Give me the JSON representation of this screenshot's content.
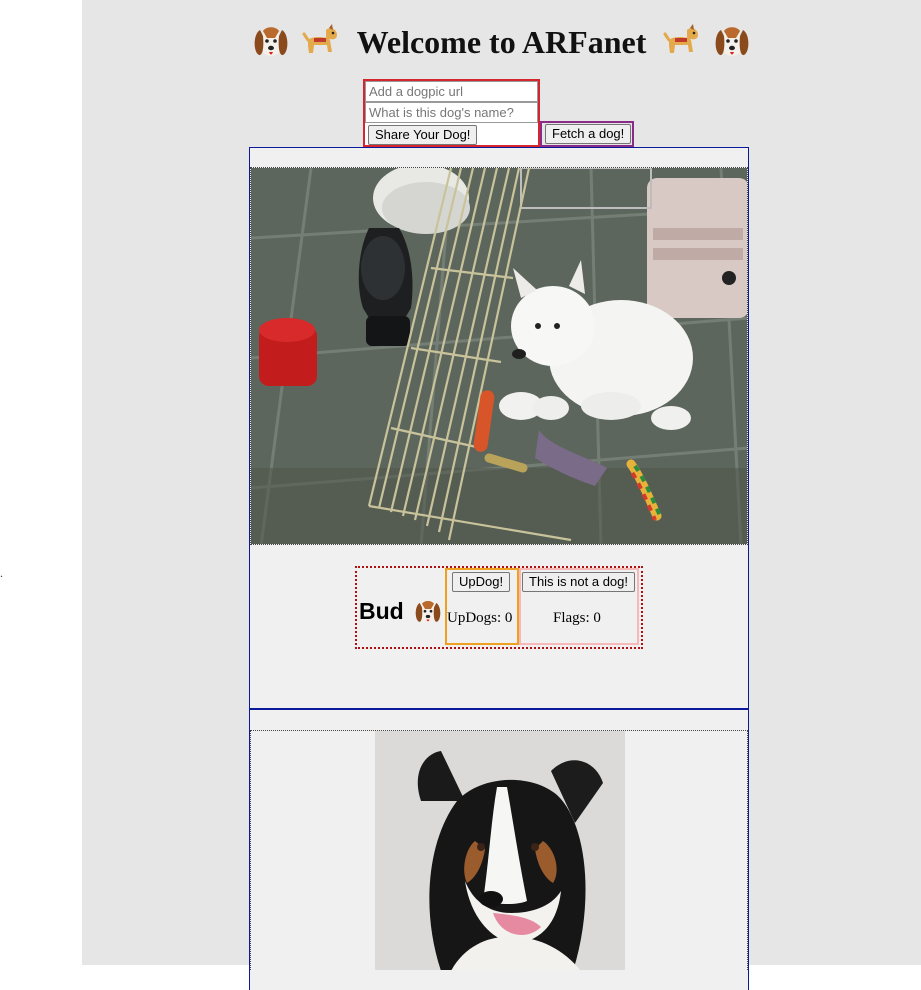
{
  "header": {
    "title": "Welcome to ARFanet",
    "emojis_left": [
      "beagle-face-emoji",
      "guide-dog-emoji"
    ],
    "emojis_right": [
      "guide-dog-emoji",
      "beagle-face-emoji"
    ]
  },
  "share_form": {
    "url_placeholder": "Add a dogpic url",
    "name_placeholder": "What is this dog's name?",
    "share_label": "Share Your Dog!"
  },
  "fetch": {
    "label": "Fetch a dog!"
  },
  "stray_text": ".",
  "dogs": [
    {
      "name": "Bud",
      "photo": "white-puppy-in-pen-photo",
      "updog_label": "UpDog!",
      "updogs_text": "UpDogs: 0",
      "flag_label": "This is not a dog!",
      "flags_text": "Flags: 0"
    },
    {
      "photo": "tricolor-shepherd-portrait-photo"
    }
  ],
  "colors": {
    "panel_bg": "#e6e6e6",
    "card_bg": "#f0f0f0",
    "card_border": "#0a1a9a",
    "share_border": "#d5262e",
    "fetch_border": "#8a2b8a",
    "updog_border": "#f0a020",
    "flag_border": "#f7b8b8",
    "info_border": "#b01010"
  }
}
